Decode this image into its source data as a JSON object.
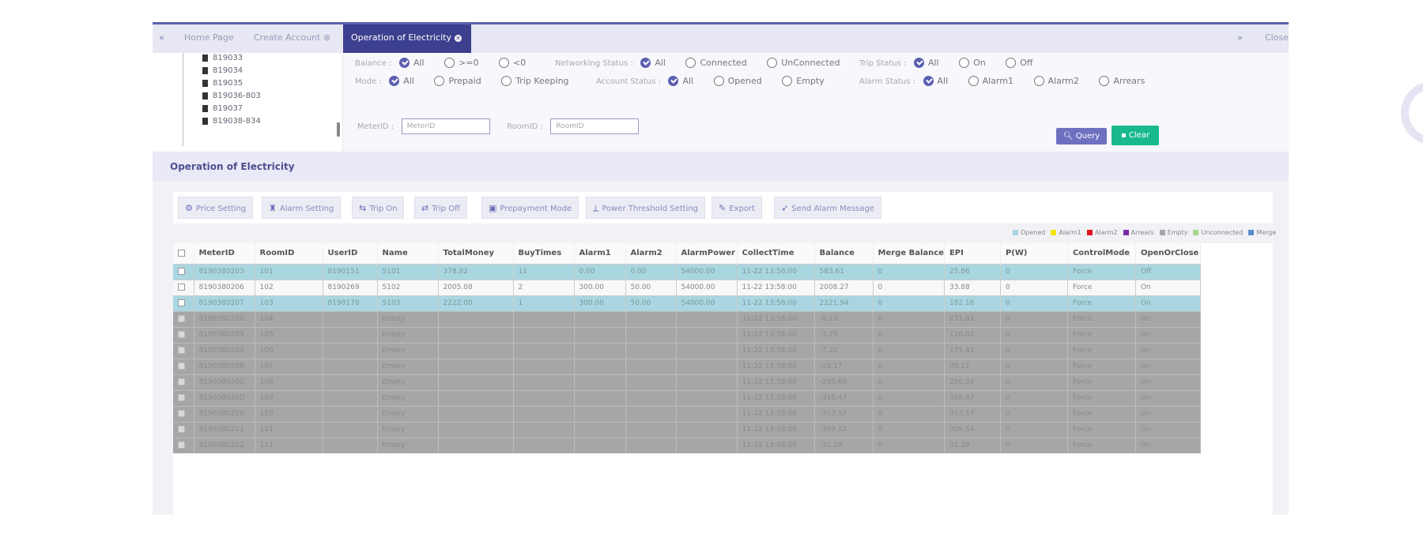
{
  "tabs": {
    "home": "Home Page",
    "create_account": "Create Account",
    "operation": "Operation of Electricity",
    "close": "Close"
  },
  "tree": {
    "items": [
      "819033",
      "819034",
      "819035",
      "819036-803",
      "819037",
      "819038-834"
    ]
  },
  "filters": {
    "balance": {
      "label": "Balance :",
      "options": [
        "All",
        ">=0",
        "<0"
      ],
      "selected": "All"
    },
    "networking_status": {
      "label": "Networking Status :",
      "options": [
        "All",
        "Connected",
        "UnConnected"
      ],
      "selected": "All"
    },
    "trip_status": {
      "label": "Trip Status :",
      "options": [
        "All",
        "On",
        "Off"
      ],
      "selected": "All"
    },
    "mode": {
      "label": "Mode :",
      "options": [
        "All",
        "Prepaid",
        "Trip Keeping"
      ],
      "selected": "All"
    },
    "account_status": {
      "label": "Account Status :",
      "options": [
        "All",
        "Opened",
        "Empty"
      ],
      "selected": "All"
    },
    "alarm_status": {
      "label": "Alarm Status :",
      "options": [
        "All",
        "Alarm1",
        "Alarm2",
        "Arrears"
      ],
      "selected": "All"
    },
    "meter_id": {
      "label": "MeterID :",
      "placeholder": "MeterID"
    },
    "room_id": {
      "label": "RoomID :",
      "placeholder": "RoomID"
    },
    "query_label": "Query",
    "clear_label": "Clear"
  },
  "section_title": "Operation of Electricity",
  "toolbar": {
    "price_setting": "Price Setting",
    "alarm_setting": "Alarm Setting",
    "trip_on": "Trip On",
    "trip_off": "Trip Off",
    "prepayment_mode": "Prepayment Mode",
    "power_threshold": "Power Threshold Setting",
    "export": "Export",
    "send_alarm": "Send Alarm Message"
  },
  "legend": [
    {
      "label": "Opened",
      "color": "#a9d6e0"
    },
    {
      "label": "Alarm1",
      "color": "#f2e600"
    },
    {
      "label": "Alarm2",
      "color": "#e0141e"
    },
    {
      "label": "Arrears",
      "color": "#7a2aa8"
    },
    {
      "label": "Empty",
      "color": "#a6a6a6"
    },
    {
      "label": "Unconnected",
      "color": "#a6d68a"
    },
    {
      "label": "Merge",
      "color": "#5b8cc8"
    }
  ],
  "table": {
    "columns": [
      "MeterID",
      "RoomID",
      "UserID",
      "Name",
      "TotalMoney",
      "BuyTimes",
      "Alarm1",
      "Alarm2",
      "AlarmPower",
      "CollectTime",
      "Balance",
      "Merge Balance",
      "EPI",
      "P(W)",
      "ControlMode",
      "OpenOrClose"
    ],
    "rows": [
      {
        "status": "opened",
        "cells": [
          "8190380203",
          "101",
          "8190151",
          "S101",
          "378.82",
          "11",
          "0.00",
          "0.00",
          "54000.00",
          "11-22 13:58:00",
          "583.61",
          "0",
          "25.86",
          "0",
          "Force",
          "Off"
        ]
      },
      {
        "status": "plain",
        "cells": [
          "8190380206",
          "102",
          "8190269",
          "S102",
          "2005.08",
          "2",
          "300.00",
          "50.00",
          "54000.00",
          "11-22 13:58:00",
          "2008.27",
          "0",
          "33.88",
          "0",
          "Force",
          "On"
        ]
      },
      {
        "status": "opened",
        "cells": [
          "8190380207",
          "103",
          "8190178",
          "S103",
          "2222.00",
          "1",
          "300.00",
          "50.00",
          "54000.00",
          "11-22 13:58:00",
          "2221.94",
          "0",
          "182.16",
          "0",
          "Force",
          "On"
        ]
      },
      {
        "status": "empty",
        "cells": [
          "8190380208",
          "104",
          "",
          "Empty",
          "",
          "",
          "",
          "",
          "",
          "11-22 13:58:00",
          "-8.19",
          "0",
          "271.81",
          "0",
          "Force",
          "On"
        ]
      },
      {
        "status": "empty",
        "cells": [
          "8190380209",
          "105",
          "",
          "Empty",
          "",
          "",
          "",
          "",
          "",
          "11-22 13:58:00",
          "-3.25",
          "0",
          "120.82",
          "0",
          "Force",
          "On"
        ]
      },
      {
        "status": "empty",
        "cells": [
          "819038020A",
          "106",
          "",
          "Empty",
          "",
          "",
          "",
          "",
          "",
          "11-22 13:58:00",
          "-7.20",
          "0",
          "171.41",
          "0",
          "Force",
          "On"
        ]
      },
      {
        "status": "empty",
        "cells": [
          "819038020B",
          "107",
          "",
          "Empty",
          "",
          "",
          "",
          "",
          "",
          "11-22 13:58:00",
          "-18.17",
          "0",
          "38.11",
          "0",
          "Force",
          "On"
        ]
      },
      {
        "status": "empty",
        "cells": [
          "819038020C",
          "108",
          "",
          "Empty",
          "",
          "",
          "",
          "",
          "",
          "11-22 13:58:00",
          "-295.68",
          "0",
          "290.84",
          "0",
          "Force",
          "On"
        ]
      },
      {
        "status": "empty",
        "cells": [
          "819038020D",
          "109",
          "",
          "Empty",
          "",
          "",
          "",
          "",
          "",
          "11-22 13:58:00",
          "-318.47",
          "0",
          "358.47",
          "0",
          "Force",
          "On"
        ]
      },
      {
        "status": "empty",
        "cells": [
          "8190380210",
          "110",
          "",
          "Empty",
          "",
          "",
          "",
          "",
          "",
          "11-22 13:58:00",
          "-313.17",
          "0",
          "313.17",
          "0",
          "Force",
          "On"
        ]
      },
      {
        "status": "empty",
        "cells": [
          "8190380211",
          "111",
          "",
          "Empty",
          "",
          "",
          "",
          "",
          "",
          "11-22 13:58:00",
          "-309.12",
          "0",
          "309.54",
          "0",
          "Force",
          "On"
        ]
      },
      {
        "status": "empty",
        "cells": [
          "8190380212",
          "111",
          "",
          "Empty",
          "",
          "",
          "",
          "",
          "",
          "11-22 13:58:00",
          "-31.29",
          "0",
          "31.29",
          "0",
          "Force",
          "On"
        ]
      }
    ]
  }
}
